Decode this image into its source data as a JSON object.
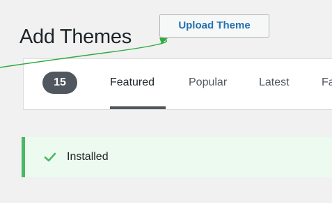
{
  "header": {
    "title": "Add Themes",
    "upload_label": "Upload Theme"
  },
  "filters": {
    "count": "15",
    "tabs": [
      {
        "label": "Featured",
        "active": true
      },
      {
        "label": "Popular"
      },
      {
        "label": "Latest"
      },
      {
        "label": "Fa"
      }
    ]
  },
  "notice": {
    "text": "Installed",
    "icon": "check-icon",
    "accent": "#4ab866",
    "background": "#edfaef"
  },
  "colors": {
    "link_blue": "#2271b1",
    "annotation_arrow": "#2eaa3f"
  }
}
